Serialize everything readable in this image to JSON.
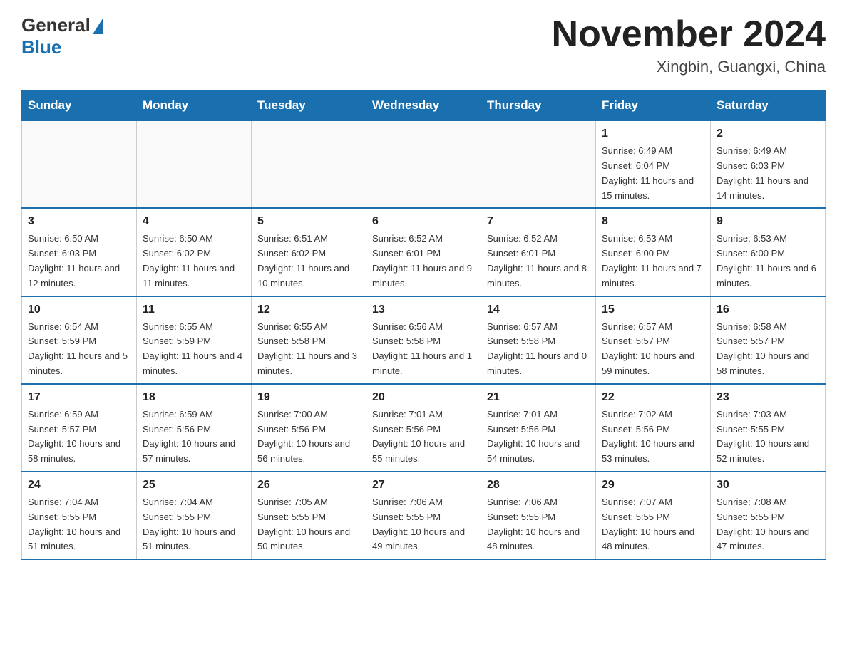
{
  "header": {
    "logo": {
      "general": "General",
      "blue": "Blue"
    },
    "title": "November 2024",
    "location": "Xingbin, Guangxi, China"
  },
  "calendar": {
    "weekdays": [
      "Sunday",
      "Monday",
      "Tuesday",
      "Wednesday",
      "Thursday",
      "Friday",
      "Saturday"
    ],
    "weeks": [
      [
        {
          "day": "",
          "info": ""
        },
        {
          "day": "",
          "info": ""
        },
        {
          "day": "",
          "info": ""
        },
        {
          "day": "",
          "info": ""
        },
        {
          "day": "",
          "info": ""
        },
        {
          "day": "1",
          "info": "Sunrise: 6:49 AM\nSunset: 6:04 PM\nDaylight: 11 hours and 15 minutes."
        },
        {
          "day": "2",
          "info": "Sunrise: 6:49 AM\nSunset: 6:03 PM\nDaylight: 11 hours and 14 minutes."
        }
      ],
      [
        {
          "day": "3",
          "info": "Sunrise: 6:50 AM\nSunset: 6:03 PM\nDaylight: 11 hours and 12 minutes."
        },
        {
          "day": "4",
          "info": "Sunrise: 6:50 AM\nSunset: 6:02 PM\nDaylight: 11 hours and 11 minutes."
        },
        {
          "day": "5",
          "info": "Sunrise: 6:51 AM\nSunset: 6:02 PM\nDaylight: 11 hours and 10 minutes."
        },
        {
          "day": "6",
          "info": "Sunrise: 6:52 AM\nSunset: 6:01 PM\nDaylight: 11 hours and 9 minutes."
        },
        {
          "day": "7",
          "info": "Sunrise: 6:52 AM\nSunset: 6:01 PM\nDaylight: 11 hours and 8 minutes."
        },
        {
          "day": "8",
          "info": "Sunrise: 6:53 AM\nSunset: 6:00 PM\nDaylight: 11 hours and 7 minutes."
        },
        {
          "day": "9",
          "info": "Sunrise: 6:53 AM\nSunset: 6:00 PM\nDaylight: 11 hours and 6 minutes."
        }
      ],
      [
        {
          "day": "10",
          "info": "Sunrise: 6:54 AM\nSunset: 5:59 PM\nDaylight: 11 hours and 5 minutes."
        },
        {
          "day": "11",
          "info": "Sunrise: 6:55 AM\nSunset: 5:59 PM\nDaylight: 11 hours and 4 minutes."
        },
        {
          "day": "12",
          "info": "Sunrise: 6:55 AM\nSunset: 5:58 PM\nDaylight: 11 hours and 3 minutes."
        },
        {
          "day": "13",
          "info": "Sunrise: 6:56 AM\nSunset: 5:58 PM\nDaylight: 11 hours and 1 minute."
        },
        {
          "day": "14",
          "info": "Sunrise: 6:57 AM\nSunset: 5:58 PM\nDaylight: 11 hours and 0 minutes."
        },
        {
          "day": "15",
          "info": "Sunrise: 6:57 AM\nSunset: 5:57 PM\nDaylight: 10 hours and 59 minutes."
        },
        {
          "day": "16",
          "info": "Sunrise: 6:58 AM\nSunset: 5:57 PM\nDaylight: 10 hours and 58 minutes."
        }
      ],
      [
        {
          "day": "17",
          "info": "Sunrise: 6:59 AM\nSunset: 5:57 PM\nDaylight: 10 hours and 58 minutes."
        },
        {
          "day": "18",
          "info": "Sunrise: 6:59 AM\nSunset: 5:56 PM\nDaylight: 10 hours and 57 minutes."
        },
        {
          "day": "19",
          "info": "Sunrise: 7:00 AM\nSunset: 5:56 PM\nDaylight: 10 hours and 56 minutes."
        },
        {
          "day": "20",
          "info": "Sunrise: 7:01 AM\nSunset: 5:56 PM\nDaylight: 10 hours and 55 minutes."
        },
        {
          "day": "21",
          "info": "Sunrise: 7:01 AM\nSunset: 5:56 PM\nDaylight: 10 hours and 54 minutes."
        },
        {
          "day": "22",
          "info": "Sunrise: 7:02 AM\nSunset: 5:56 PM\nDaylight: 10 hours and 53 minutes."
        },
        {
          "day": "23",
          "info": "Sunrise: 7:03 AM\nSunset: 5:55 PM\nDaylight: 10 hours and 52 minutes."
        }
      ],
      [
        {
          "day": "24",
          "info": "Sunrise: 7:04 AM\nSunset: 5:55 PM\nDaylight: 10 hours and 51 minutes."
        },
        {
          "day": "25",
          "info": "Sunrise: 7:04 AM\nSunset: 5:55 PM\nDaylight: 10 hours and 51 minutes."
        },
        {
          "day": "26",
          "info": "Sunrise: 7:05 AM\nSunset: 5:55 PM\nDaylight: 10 hours and 50 minutes."
        },
        {
          "day": "27",
          "info": "Sunrise: 7:06 AM\nSunset: 5:55 PM\nDaylight: 10 hours and 49 minutes."
        },
        {
          "day": "28",
          "info": "Sunrise: 7:06 AM\nSunset: 5:55 PM\nDaylight: 10 hours and 48 minutes."
        },
        {
          "day": "29",
          "info": "Sunrise: 7:07 AM\nSunset: 5:55 PM\nDaylight: 10 hours and 48 minutes."
        },
        {
          "day": "30",
          "info": "Sunrise: 7:08 AM\nSunset: 5:55 PM\nDaylight: 10 hours and 47 minutes."
        }
      ]
    ]
  }
}
